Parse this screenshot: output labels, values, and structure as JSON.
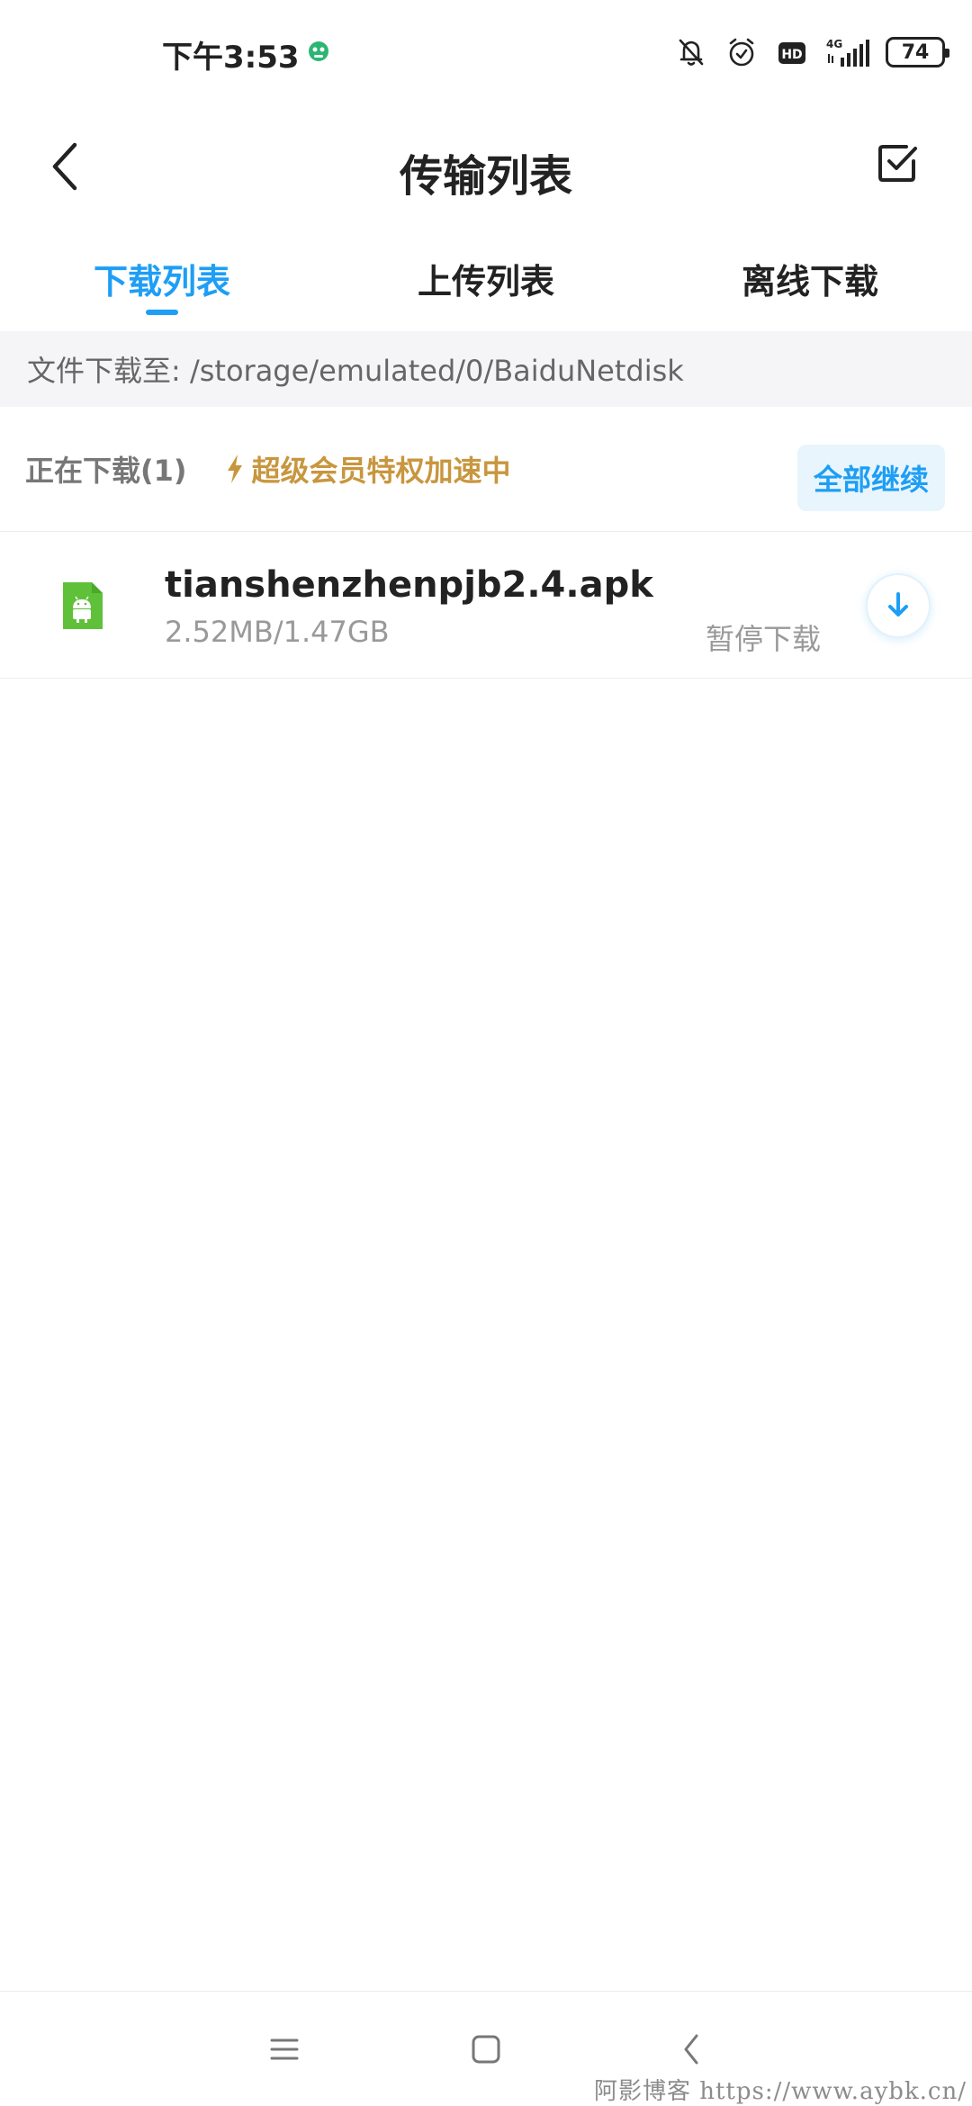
{
  "status_bar": {
    "time": "下午3:53",
    "network": "4G",
    "battery": "74"
  },
  "header": {
    "title": "传输列表"
  },
  "tabs": [
    {
      "label": "下载列表",
      "active": true
    },
    {
      "label": "上传列表",
      "active": false
    },
    {
      "label": "离线下载",
      "active": false
    }
  ],
  "path": {
    "text": "文件下载至: /storage/emulated/0/BaiduNetdisk"
  },
  "downloading": {
    "label": "正在下载(1)",
    "vip_text": "超级会员特权加速中",
    "resume_all_label": "全部继续"
  },
  "files": [
    {
      "name": "tianshenzhenpjb2.4.apk",
      "size": "2.52MB/1.47GB",
      "status": "暂停下载",
      "icon": "android-apk-icon"
    }
  ],
  "watermark": "阿影博客 https://www.aybk.cn/",
  "colors": {
    "accent": "#1e9ef5",
    "vip": "#c8963e",
    "apk_icon": "#5fc13a"
  }
}
